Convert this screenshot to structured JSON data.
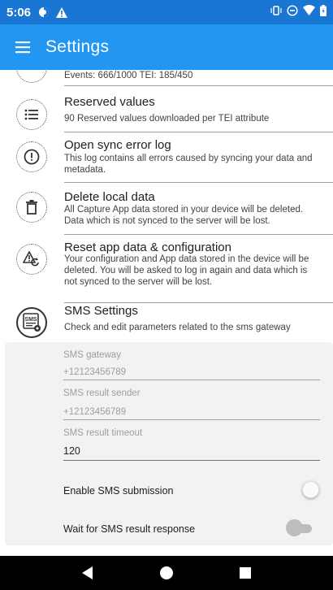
{
  "status_bar": {
    "time": "5:06"
  },
  "app_bar": {
    "title": "Settings",
    "menu_icon": "hamburger-menu-icon"
  },
  "settings": {
    "sync_partial_desc": "Events: 666/1000 TEI: 185/450",
    "reserved_values": {
      "title": "Reserved values",
      "desc": "90 Reserved values downloaded per TEI attribute",
      "icon": "list-icon"
    },
    "sync_error_log": {
      "title": "Open sync error log",
      "desc": "This log contains all errors caused by syncing your data and metadata.",
      "icon": "exclamation-circle-icon"
    },
    "delete_local_data": {
      "title": "Delete local data",
      "desc": "All Capture App data stored in your device will be deleted. Data which is not synced to the server will be lost.",
      "icon": "trash-icon"
    },
    "reset_app": {
      "title": "Reset app data & configuration",
      "desc": "Your configuration and App data stored in the device will be deleted. You will be asked to log in again and data which is not synced to the server will be lost.",
      "icon": "reset-warning-icon"
    },
    "sms_settings": {
      "title": "SMS Settings",
      "desc": "Check and edit parameters related to the sms gateway",
      "icon": "sms-settings-icon",
      "sms_icon_text": "SMS",
      "gateway_label": "SMS gateway",
      "gateway_value": "+12123456789",
      "result_sender_label": "SMS result sender",
      "result_sender_value": "+12123456789",
      "result_timeout_label": "SMS result timeout",
      "result_timeout_value": "120",
      "enable_submission_label": "Enable SMS submission",
      "enable_submission_on": false,
      "wait_response_label": "Wait for SMS result response",
      "wait_response_on": false
    }
  },
  "colors": {
    "status_bar": "#1976d2",
    "app_bar": "#2196f3",
    "panel": "#f2f2f2"
  }
}
